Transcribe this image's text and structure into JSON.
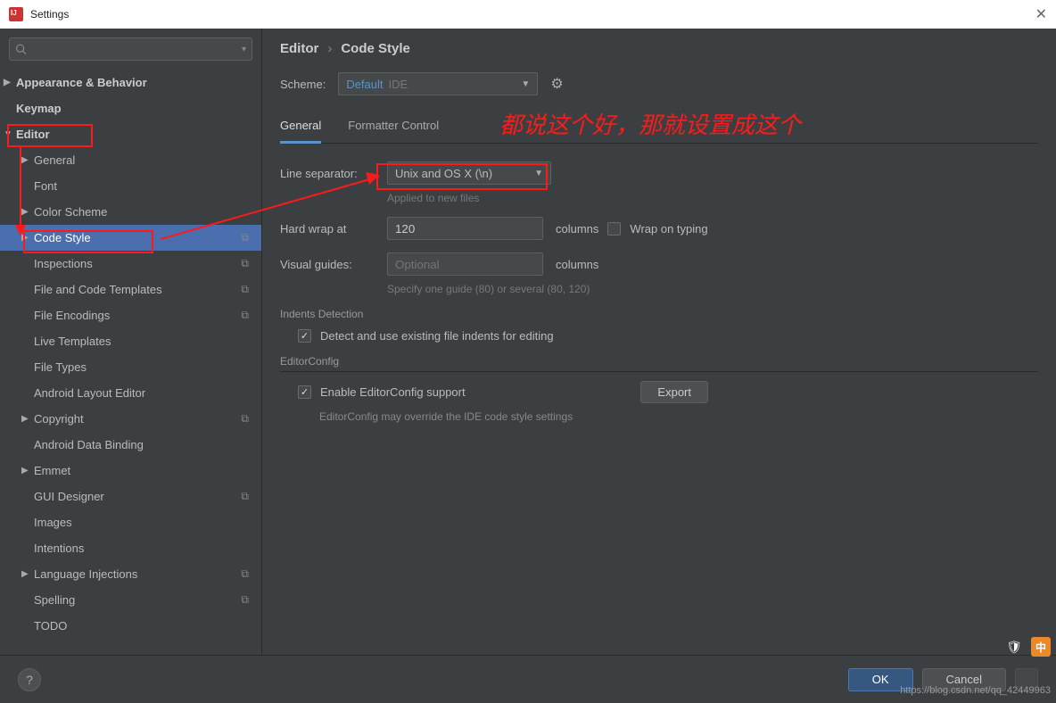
{
  "window": {
    "title": "Settings"
  },
  "search": {
    "placeholder": ""
  },
  "sidebar": {
    "items": [
      {
        "label": "Appearance & Behavior",
        "arrow": "▶",
        "bold": true,
        "indent": 0
      },
      {
        "label": "Keymap",
        "arrow": "",
        "bold": true,
        "indent": 0
      },
      {
        "label": "Editor",
        "arrow": "▼",
        "bold": true,
        "indent": 0
      },
      {
        "label": "General",
        "arrow": "▶",
        "bold": false,
        "indent": 1
      },
      {
        "label": "Font",
        "arrow": "",
        "bold": false,
        "indent": 1
      },
      {
        "label": "Color Scheme",
        "arrow": "▶",
        "bold": false,
        "indent": 1
      },
      {
        "label": "Code Style",
        "arrow": "▶",
        "bold": false,
        "indent": 1,
        "selected": true,
        "copy": true
      },
      {
        "label": "Inspections",
        "arrow": "",
        "bold": false,
        "indent": 1,
        "copy": true
      },
      {
        "label": "File and Code Templates",
        "arrow": "",
        "bold": false,
        "indent": 1,
        "copy": true
      },
      {
        "label": "File Encodings",
        "arrow": "",
        "bold": false,
        "indent": 1,
        "copy": true
      },
      {
        "label": "Live Templates",
        "arrow": "",
        "bold": false,
        "indent": 1
      },
      {
        "label": "File Types",
        "arrow": "",
        "bold": false,
        "indent": 1
      },
      {
        "label": "Android Layout Editor",
        "arrow": "",
        "bold": false,
        "indent": 1
      },
      {
        "label": "Copyright",
        "arrow": "▶",
        "bold": false,
        "indent": 1,
        "copy": true
      },
      {
        "label": "Android Data Binding",
        "arrow": "",
        "bold": false,
        "indent": 1
      },
      {
        "label": "Emmet",
        "arrow": "▶",
        "bold": false,
        "indent": 1
      },
      {
        "label": "GUI Designer",
        "arrow": "",
        "bold": false,
        "indent": 1,
        "copy": true
      },
      {
        "label": "Images",
        "arrow": "",
        "bold": false,
        "indent": 1
      },
      {
        "label": "Intentions",
        "arrow": "",
        "bold": false,
        "indent": 1
      },
      {
        "label": "Language Injections",
        "arrow": "▶",
        "bold": false,
        "indent": 1,
        "copy": true
      },
      {
        "label": "Spelling",
        "arrow": "",
        "bold": false,
        "indent": 1,
        "copy": true
      },
      {
        "label": "TODO",
        "arrow": "",
        "bold": false,
        "indent": 1
      }
    ]
  },
  "breadcrumb": {
    "parent": "Editor",
    "sep": "›",
    "current": "Code Style"
  },
  "scheme": {
    "label": "Scheme:",
    "valueDefault": "Default",
    "valueIde": "IDE"
  },
  "tabs": {
    "general": "General",
    "formatter": "Formatter Control"
  },
  "form": {
    "lineSep": {
      "label": "Line separator:",
      "value": "Unix and OS X (\\n)",
      "hint": "Applied to new files"
    },
    "hardWrap": {
      "label": "Hard wrap at",
      "value": "120",
      "unit": "columns",
      "wrapOnTyping": "Wrap on typing"
    },
    "visualGuides": {
      "label": "Visual guides:",
      "placeholder": "Optional",
      "unit": "columns",
      "hint": "Specify one guide (80) or several (80, 120)"
    },
    "indents": {
      "section": "Indents Detection",
      "detect": "Detect and use existing file indents for editing"
    },
    "editorConfig": {
      "section": "EditorConfig",
      "enable": "Enable EditorConfig support",
      "export": "Export",
      "note": "EditorConfig may override the IDE code style settings"
    }
  },
  "footer": {
    "ok": "OK",
    "cancel": "Cancel"
  },
  "annotation": {
    "text": "都说这个好，那就设置成这个"
  },
  "watermark": "https://blog.csdn.net/qq_42449963"
}
